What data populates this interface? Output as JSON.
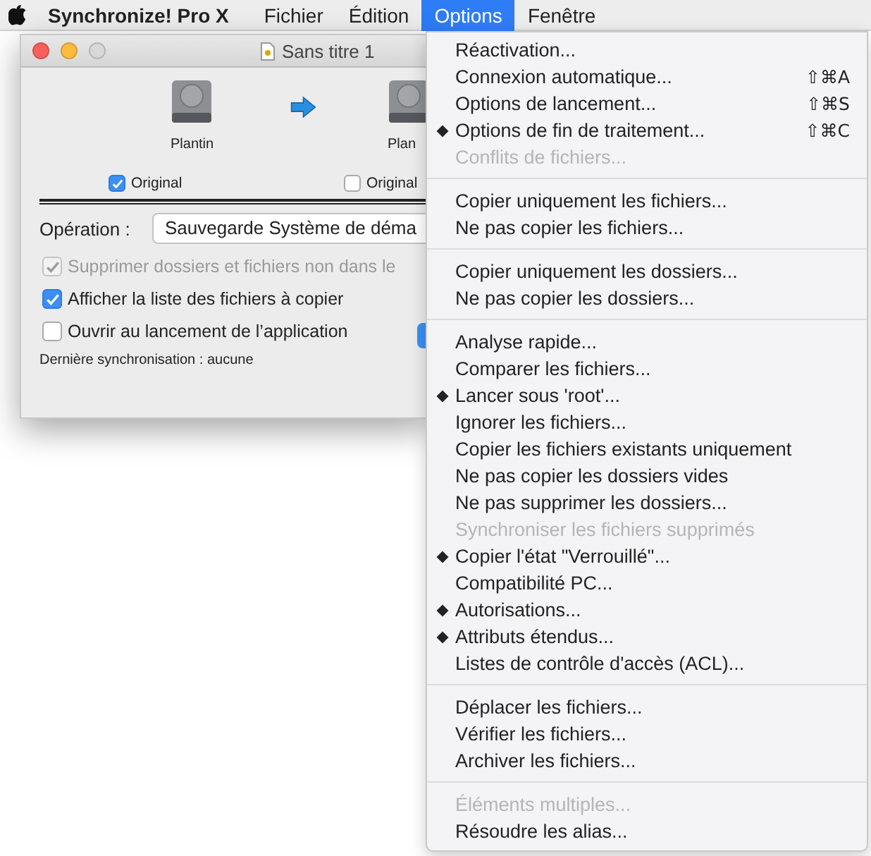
{
  "menubar": {
    "app_name": "Synchronize! Pro X",
    "menus": [
      {
        "label": "Fichier",
        "selected": false
      },
      {
        "label": "Édition",
        "selected": false
      },
      {
        "label": "Options",
        "selected": true
      },
      {
        "label": "Fenêtre",
        "selected": false
      }
    ]
  },
  "window": {
    "title": "Sans titre 1",
    "source": {
      "name": "Plantin",
      "checkbox": {
        "label": "Original",
        "checked": true
      }
    },
    "destination": {
      "name": "Plan",
      "checkbox": {
        "label": "Original",
        "checked": false
      }
    },
    "operation": {
      "label": "Opération :",
      "value": "Sauvegarde Système de déma"
    },
    "options": [
      {
        "label": "Supprimer dossiers et fichiers non dans le",
        "checked": true,
        "disabled": true
      },
      {
        "label": "Afficher la liste des fichiers à copier",
        "checked": true,
        "disabled": false
      },
      {
        "label": "Ouvrir au lancement de l’application",
        "checked": false,
        "disabled": false
      }
    ],
    "last_sync": "Dernière synchronisation : aucune"
  },
  "menu": {
    "sections": [
      [
        {
          "label": "Réactivation...",
          "marked": false,
          "disabled": false
        },
        {
          "label": "Connexion automatique...",
          "marked": false,
          "disabled": false,
          "shortcut": "⇧⌘A"
        },
        {
          "label": "Options de lancement...",
          "marked": false,
          "disabled": false,
          "shortcut": "⇧⌘S"
        },
        {
          "label": "Options de fin de traitement...",
          "marked": true,
          "disabled": false,
          "shortcut": "⇧⌘C"
        },
        {
          "label": "Conflits de fichiers...",
          "marked": false,
          "disabled": true
        }
      ],
      [
        {
          "label": "Copier uniquement les fichiers...",
          "marked": false,
          "disabled": false
        },
        {
          "label": "Ne pas copier les fichiers...",
          "marked": false,
          "disabled": false
        }
      ],
      [
        {
          "label": "Copier uniquement les dossiers...",
          "marked": false,
          "disabled": false
        },
        {
          "label": "Ne pas copier les dossiers...",
          "marked": false,
          "disabled": false
        }
      ],
      [
        {
          "label": "Analyse rapide...",
          "marked": false,
          "disabled": false
        },
        {
          "label": "Comparer les fichiers...",
          "marked": false,
          "disabled": false
        },
        {
          "label": "Lancer sous 'root'...",
          "marked": true,
          "disabled": false
        },
        {
          "label": "Ignorer les fichiers...",
          "marked": false,
          "disabled": false
        },
        {
          "label": "Copier les fichiers existants uniquement",
          "marked": false,
          "disabled": false
        },
        {
          "label": "Ne pas copier les dossiers vides",
          "marked": false,
          "disabled": false
        },
        {
          "label": "Ne pas supprimer les dossiers...",
          "marked": false,
          "disabled": false
        },
        {
          "label": "Synchroniser les fichiers supprimés",
          "marked": false,
          "disabled": true
        },
        {
          "label": "Copier l'état \"Verrouillé\"...",
          "marked": true,
          "disabled": false
        },
        {
          "label": "Compatibilité PC...",
          "marked": false,
          "disabled": false
        },
        {
          "label": "Autorisations...",
          "marked": true,
          "disabled": false
        },
        {
          "label": "Attributs étendus...",
          "marked": true,
          "disabled": false
        },
        {
          "label": "Listes de contrôle d'accès (ACL)...",
          "marked": false,
          "disabled": false
        }
      ],
      [
        {
          "label": "Déplacer les fichiers...",
          "marked": false,
          "disabled": false
        },
        {
          "label": "Vérifier les fichiers...",
          "marked": false,
          "disabled": false
        },
        {
          "label": "Archiver les fichiers...",
          "marked": false,
          "disabled": false
        }
      ],
      [
        {
          "label": "Éléments multiples...",
          "marked": false,
          "disabled": true
        },
        {
          "label": "Résoudre les alias...",
          "marked": false,
          "disabled": false
        }
      ]
    ]
  }
}
